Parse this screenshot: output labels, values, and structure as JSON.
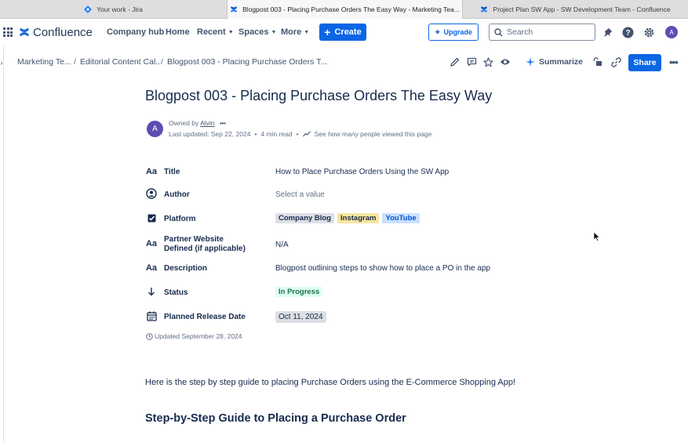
{
  "browser_tabs": [
    {
      "title": "Your work - Jira",
      "active": false
    },
    {
      "title": "Blogpost 003 - Placing Purchase Orders The Easy Way - Marketing Tea...",
      "active": true
    },
    {
      "title": "Project Plan SW App - SW Development Team - Confluence",
      "active": false
    }
  ],
  "nav": {
    "app_name": "Confluence",
    "items": [
      "Company hub",
      "Home",
      "Recent",
      "Spaces",
      "More"
    ],
    "create_label": "Create",
    "upgrade_label": "Upgrade",
    "search_placeholder": "Search",
    "avatar_initial": "A",
    "brand_color": "#0c66e4"
  },
  "breadcrumb": [
    "Marketing Te...",
    "Editorial Content Cal...",
    "Blogpost 003 - Placing Purchase Orders T..."
  ],
  "toolbar": {
    "summarize_label": "Summarize",
    "share_label": "Share"
  },
  "page": {
    "title": "Blogpost 003 - Placing Purchase Orders The Easy Way",
    "owner_prefix": "Owned by",
    "owner": "Alvin",
    "avatar_initial": "A",
    "last_updated": "Last updated: Sep 22, 2024",
    "read_time": "4 min read",
    "views_link": "See how many people viewed this page"
  },
  "properties": {
    "title": {
      "label": "Title",
      "icon": "Aa",
      "value": "How to Place Purchase Orders Using the SW App"
    },
    "author": {
      "label": "Author",
      "value": "Select a value"
    },
    "platform": {
      "label": "Platform",
      "tags": [
        "Company Blog",
        "Instagram",
        "YouTube"
      ]
    },
    "partner": {
      "label_line1": "Partner Website",
      "label_line2": "Defined (if applicable)",
      "icon": "Aa",
      "value": "N/A"
    },
    "description": {
      "label": "Description",
      "icon": "Aa",
      "value": "Blogpost outlining steps to show how to place a PO in the app"
    },
    "status": {
      "label": "Status",
      "value": "In Progress"
    },
    "release": {
      "label": "Planned Release Date",
      "value": "Oct 11, 2024"
    }
  },
  "updated_note": "Updated September 28, 2024",
  "body": {
    "intro": "Here is the step by step guide to placing Purchase Orders using the E-Commerce Shopping App!",
    "heading": "Step-by-Step Guide to Placing a Purchase Order"
  }
}
